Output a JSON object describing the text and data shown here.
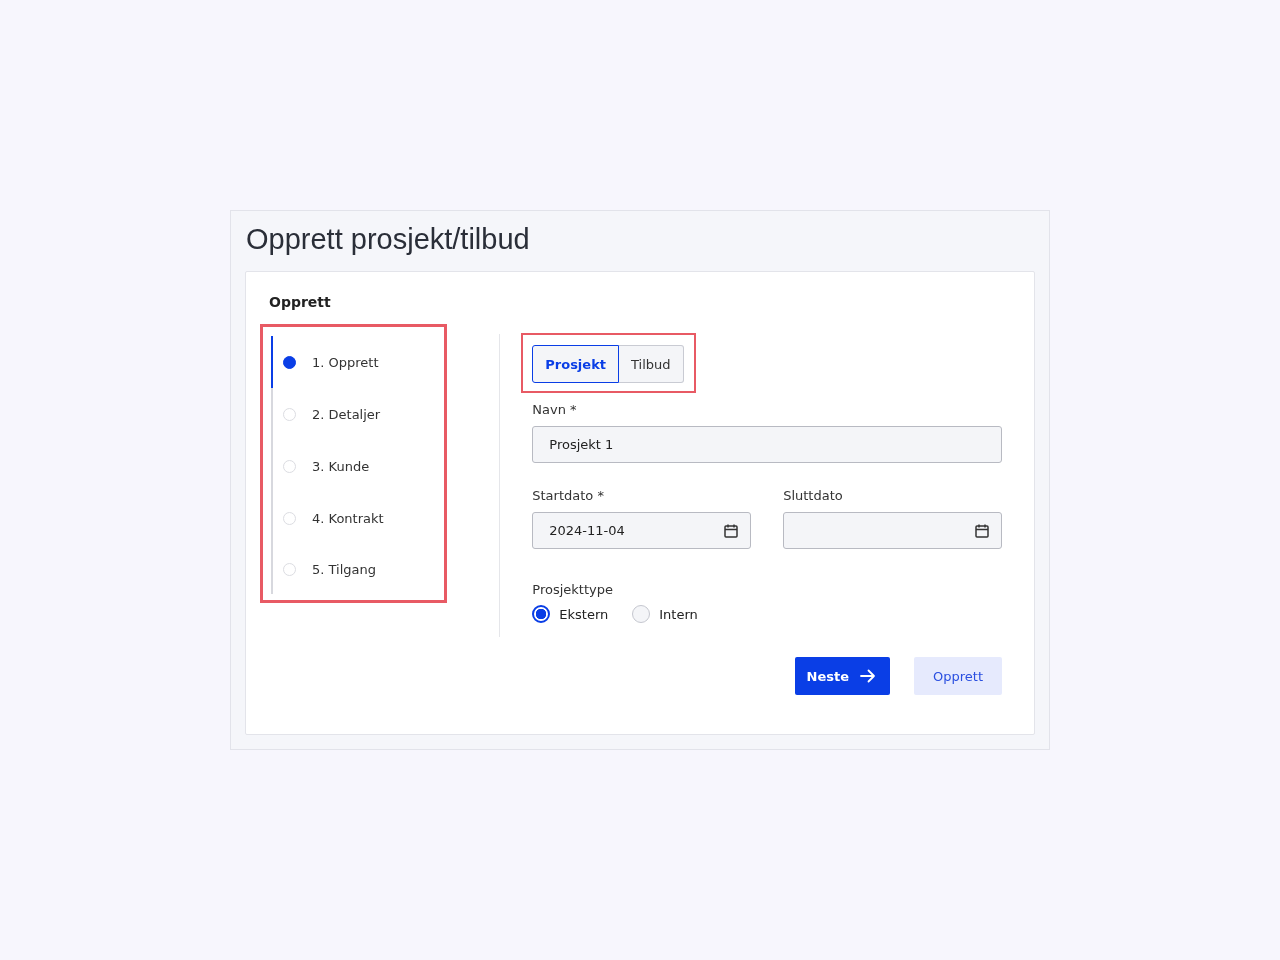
{
  "page": {
    "title": "Opprett prosjekt/tilbud"
  },
  "card": {
    "heading": "Opprett"
  },
  "steps": {
    "highlighted": true,
    "items": [
      {
        "label": "1. Opprett",
        "selected": true
      },
      {
        "label": "2. Detaljer",
        "selected": false
      },
      {
        "label": "3. Kunde",
        "selected": false
      },
      {
        "label": "4. Kontrakt",
        "selected": false
      },
      {
        "label": "5. Tilgang",
        "selected": false
      }
    ]
  },
  "mode_toggle": {
    "highlighted": true,
    "options": [
      {
        "label": "Prosjekt",
        "selected": true
      },
      {
        "label": "Tilbud",
        "selected": false
      }
    ]
  },
  "name_field": {
    "label": "Navn *",
    "value": "Prosjekt 1"
  },
  "start_date": {
    "label": "Startdato *",
    "value": "2024-11-04"
  },
  "end_date": {
    "label": "Sluttdato"
  },
  "project_type": {
    "label": "Prosjekttype",
    "options": [
      {
        "label": "Ekstern",
        "selected": true
      },
      {
        "label": "Intern",
        "selected": false
      }
    ]
  },
  "buttons": {
    "next": "Neste",
    "create": "Opprett"
  }
}
